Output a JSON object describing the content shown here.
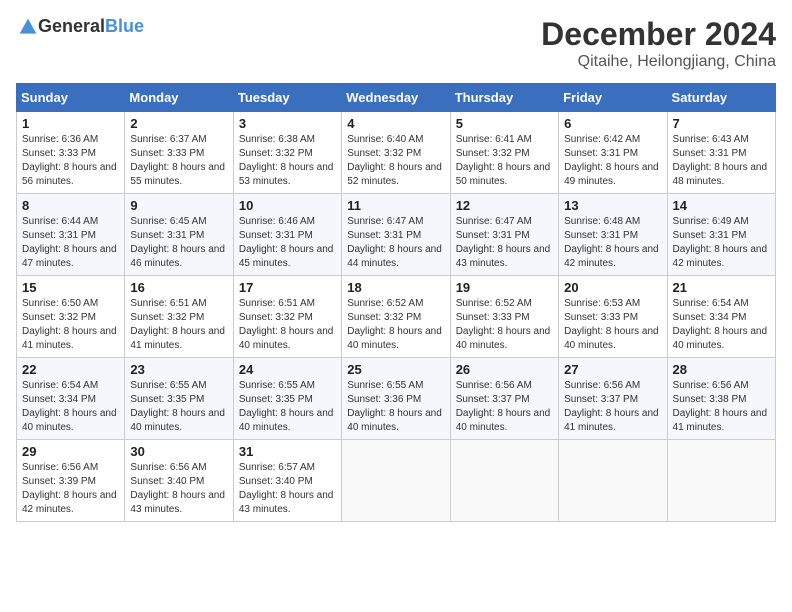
{
  "header": {
    "logo_general": "General",
    "logo_blue": "Blue",
    "month": "December 2024",
    "location": "Qitaihe, Heilongjiang, China"
  },
  "weekdays": [
    "Sunday",
    "Monday",
    "Tuesday",
    "Wednesday",
    "Thursday",
    "Friday",
    "Saturday"
  ],
  "weeks": [
    [
      {
        "day": "1",
        "sunrise": "6:36 AM",
        "sunset": "3:33 PM",
        "daylight": "8 hours and 56 minutes."
      },
      {
        "day": "2",
        "sunrise": "6:37 AM",
        "sunset": "3:33 PM",
        "daylight": "8 hours and 55 minutes."
      },
      {
        "day": "3",
        "sunrise": "6:38 AM",
        "sunset": "3:32 PM",
        "daylight": "8 hours and 53 minutes."
      },
      {
        "day": "4",
        "sunrise": "6:40 AM",
        "sunset": "3:32 PM",
        "daylight": "8 hours and 52 minutes."
      },
      {
        "day": "5",
        "sunrise": "6:41 AM",
        "sunset": "3:32 PM",
        "daylight": "8 hours and 50 minutes."
      },
      {
        "day": "6",
        "sunrise": "6:42 AM",
        "sunset": "3:31 PM",
        "daylight": "8 hours and 49 minutes."
      },
      {
        "day": "7",
        "sunrise": "6:43 AM",
        "sunset": "3:31 PM",
        "daylight": "8 hours and 48 minutes."
      }
    ],
    [
      {
        "day": "8",
        "sunrise": "6:44 AM",
        "sunset": "3:31 PM",
        "daylight": "8 hours and 47 minutes."
      },
      {
        "day": "9",
        "sunrise": "6:45 AM",
        "sunset": "3:31 PM",
        "daylight": "8 hours and 46 minutes."
      },
      {
        "day": "10",
        "sunrise": "6:46 AM",
        "sunset": "3:31 PM",
        "daylight": "8 hours and 45 minutes."
      },
      {
        "day": "11",
        "sunrise": "6:47 AM",
        "sunset": "3:31 PM",
        "daylight": "8 hours and 44 minutes."
      },
      {
        "day": "12",
        "sunrise": "6:47 AM",
        "sunset": "3:31 PM",
        "daylight": "8 hours and 43 minutes."
      },
      {
        "day": "13",
        "sunrise": "6:48 AM",
        "sunset": "3:31 PM",
        "daylight": "8 hours and 42 minutes."
      },
      {
        "day": "14",
        "sunrise": "6:49 AM",
        "sunset": "3:31 PM",
        "daylight": "8 hours and 42 minutes."
      }
    ],
    [
      {
        "day": "15",
        "sunrise": "6:50 AM",
        "sunset": "3:32 PM",
        "daylight": "8 hours and 41 minutes."
      },
      {
        "day": "16",
        "sunrise": "6:51 AM",
        "sunset": "3:32 PM",
        "daylight": "8 hours and 41 minutes."
      },
      {
        "day": "17",
        "sunrise": "6:51 AM",
        "sunset": "3:32 PM",
        "daylight": "8 hours and 40 minutes."
      },
      {
        "day": "18",
        "sunrise": "6:52 AM",
        "sunset": "3:32 PM",
        "daylight": "8 hours and 40 minutes."
      },
      {
        "day": "19",
        "sunrise": "6:52 AM",
        "sunset": "3:33 PM",
        "daylight": "8 hours and 40 minutes."
      },
      {
        "day": "20",
        "sunrise": "6:53 AM",
        "sunset": "3:33 PM",
        "daylight": "8 hours and 40 minutes."
      },
      {
        "day": "21",
        "sunrise": "6:54 AM",
        "sunset": "3:34 PM",
        "daylight": "8 hours and 40 minutes."
      }
    ],
    [
      {
        "day": "22",
        "sunrise": "6:54 AM",
        "sunset": "3:34 PM",
        "daylight": "8 hours and 40 minutes."
      },
      {
        "day": "23",
        "sunrise": "6:55 AM",
        "sunset": "3:35 PM",
        "daylight": "8 hours and 40 minutes."
      },
      {
        "day": "24",
        "sunrise": "6:55 AM",
        "sunset": "3:35 PM",
        "daylight": "8 hours and 40 minutes."
      },
      {
        "day": "25",
        "sunrise": "6:55 AM",
        "sunset": "3:36 PM",
        "daylight": "8 hours and 40 minutes."
      },
      {
        "day": "26",
        "sunrise": "6:56 AM",
        "sunset": "3:37 PM",
        "daylight": "8 hours and 40 minutes."
      },
      {
        "day": "27",
        "sunrise": "6:56 AM",
        "sunset": "3:37 PM",
        "daylight": "8 hours and 41 minutes."
      },
      {
        "day": "28",
        "sunrise": "6:56 AM",
        "sunset": "3:38 PM",
        "daylight": "8 hours and 41 minutes."
      }
    ],
    [
      {
        "day": "29",
        "sunrise": "6:56 AM",
        "sunset": "3:39 PM",
        "daylight": "8 hours and 42 minutes."
      },
      {
        "day": "30",
        "sunrise": "6:56 AM",
        "sunset": "3:40 PM",
        "daylight": "8 hours and 43 minutes."
      },
      {
        "day": "31",
        "sunrise": "6:57 AM",
        "sunset": "3:40 PM",
        "daylight": "8 hours and 43 minutes."
      },
      null,
      null,
      null,
      null
    ]
  ]
}
